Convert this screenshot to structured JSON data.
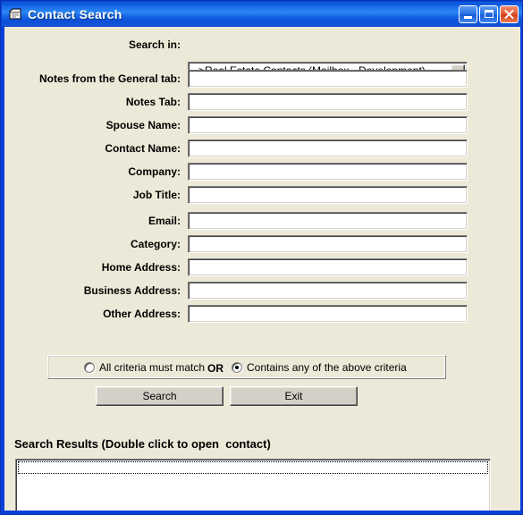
{
  "window": {
    "title": "Contact Search",
    "icon": "form-window-icon",
    "controls": {
      "minimize": "Minimize",
      "maximize": "Maximize",
      "close": "Close"
    },
    "colors": {
      "titlebar_blue": "#0d57dd",
      "client_bg": "#ece9d8",
      "button_face": "#d4d0c8",
      "close_red": "#e35e36",
      "field_bg": "#ffffff"
    }
  },
  "search_in": {
    "label": "Search in:",
    "value": "-->Real Estate Contacts (Mailbox - Development)",
    "placeholder": ""
  },
  "fields": [
    {
      "label": "Notes from the General tab:",
      "value": "",
      "placeholder": "",
      "name": "notes-general-tab"
    },
    {
      "label": "Notes Tab:",
      "value": "",
      "placeholder": "",
      "name": "notes-tab"
    },
    {
      "label": "Spouse Name:",
      "value": "",
      "placeholder": "",
      "name": "spouse-name"
    },
    {
      "label": "Contact Name:",
      "value": "",
      "placeholder": "",
      "name": "contact-name"
    },
    {
      "label": "Company:",
      "value": "",
      "placeholder": "",
      "name": "company"
    },
    {
      "label": "Job Title:",
      "value": "",
      "placeholder": "",
      "name": "job-title"
    },
    {
      "label": "Email:",
      "value": "",
      "placeholder": "",
      "name": "email"
    },
    {
      "label": "Category:",
      "value": "",
      "placeholder": "",
      "name": "category"
    },
    {
      "label": "Home Address:",
      "value": "",
      "placeholder": "",
      "name": "home-address"
    },
    {
      "label": "Business Address:",
      "value": "",
      "placeholder": "",
      "name": "business-address"
    },
    {
      "label": "Other Address:",
      "value": "",
      "placeholder": "",
      "name": "other-address"
    }
  ],
  "criteria": {
    "option_all": "All criteria must match",
    "separator": "OR",
    "option_any": "Contains any of the above criteria",
    "selected": "any"
  },
  "buttons": {
    "search": "Search",
    "exit": "Exit"
  },
  "results": {
    "label": "Search Results (Double click to open  contact)",
    "items": []
  }
}
